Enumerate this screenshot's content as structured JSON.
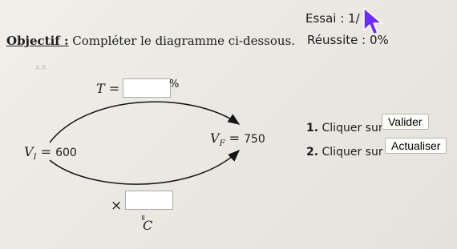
{
  "header": {
    "objectif_label": "Objectif :",
    "objectif_text": "Compléter le diagramme ci-dessous.",
    "essai": "Essai : 1/",
    "reussite": "Réussite : 0%"
  },
  "diagram": {
    "t_label": "T =",
    "t_unit": "%",
    "vi_label": "V",
    "vi_sub": "I",
    "vi_eq": " = ",
    "vi_value": "600",
    "vf_label": "V",
    "vf_sub": "F",
    "vf_eq": " = ",
    "vf_value": "750",
    "times_symbol": "×",
    "equals_symbol": "॥",
    "c_label": "C",
    "t_input_value": "",
    "c_input_value": ""
  },
  "steps": [
    {
      "number": "1.",
      "text": "Cliquer sur",
      "button": "Valider"
    },
    {
      "number": "2.",
      "text": "Cliquer sur",
      "button": "Actualiser"
    }
  ],
  "colors": {
    "cursor": "#6d2bff",
    "arrow": "#151515"
  },
  "icons": {
    "cursor": "mouse-pointer-icon"
  }
}
